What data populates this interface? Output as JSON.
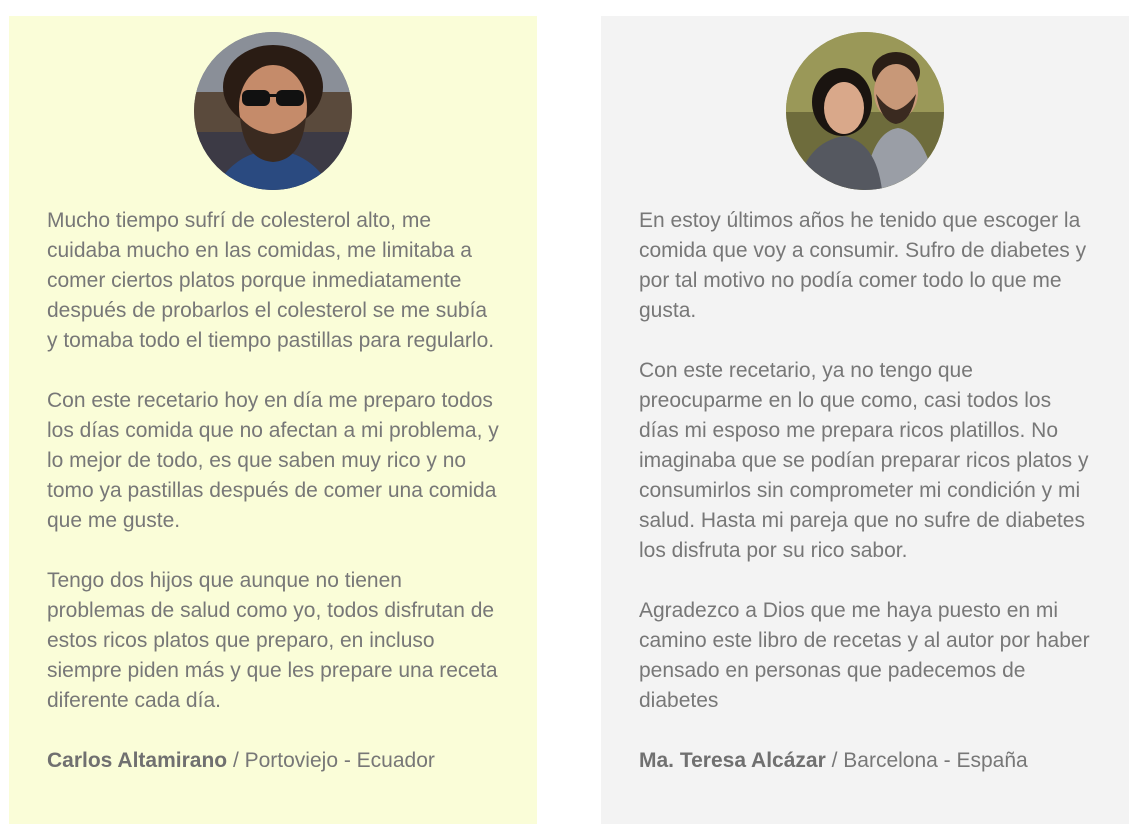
{
  "testimonials": [
    {
      "paragraphs": [
        "Mucho tiempo sufrí de colesterol alto, me cuidaba mucho en las comidas, me limitaba a comer ciertos platos porque inmediatamente después de probarlos el colesterol se me subía y tomaba todo el tiempo pastillas para regularlo.",
        "Con este recetario hoy en día me preparo todos los días comida que no afectan a mi problema, y lo mejor de todo, es que saben muy rico y no tomo ya pastillas después de comer una comida que me guste.",
        "Tengo dos hijos que aunque no tienen problemas de salud como yo, todos disfrutan de estos ricos platos que preparo, en incluso siempre piden más y que les prepare una receta diferente cada día."
      ],
      "author_name": "Carlos Altamirano",
      "author_location": " / Portoviejo - Ecuador",
      "background": "#fafdd8"
    },
    {
      "paragraphs": [
        "En estoy últimos años he tenido que escoger la comida que voy a consumir. Sufro de diabetes y por tal motivo no podía comer todo lo que me gusta.",
        "Con este recetario, ya no tengo que preocuparme en lo que como, casi todos los días mi esposo me prepara ricos platillos. No imaginaba que se podían preparar ricos platos y consumirlos sin comprometer mi condición y mi salud. Hasta mi pareja que no sufre de diabetes los disfruta por su rico sabor.",
        "Agradezco a Dios que me haya puesto en mi camino este libro de recetas y al autor por haber pensado en personas que padecemos de diabetes"
      ],
      "author_name": "Ma. Teresa Alcázar",
      "author_location": " / Barcelona - España",
      "background": "#f3f3f3"
    }
  ],
  "colors": {
    "text": "#777777",
    "author_name": "#707070"
  }
}
